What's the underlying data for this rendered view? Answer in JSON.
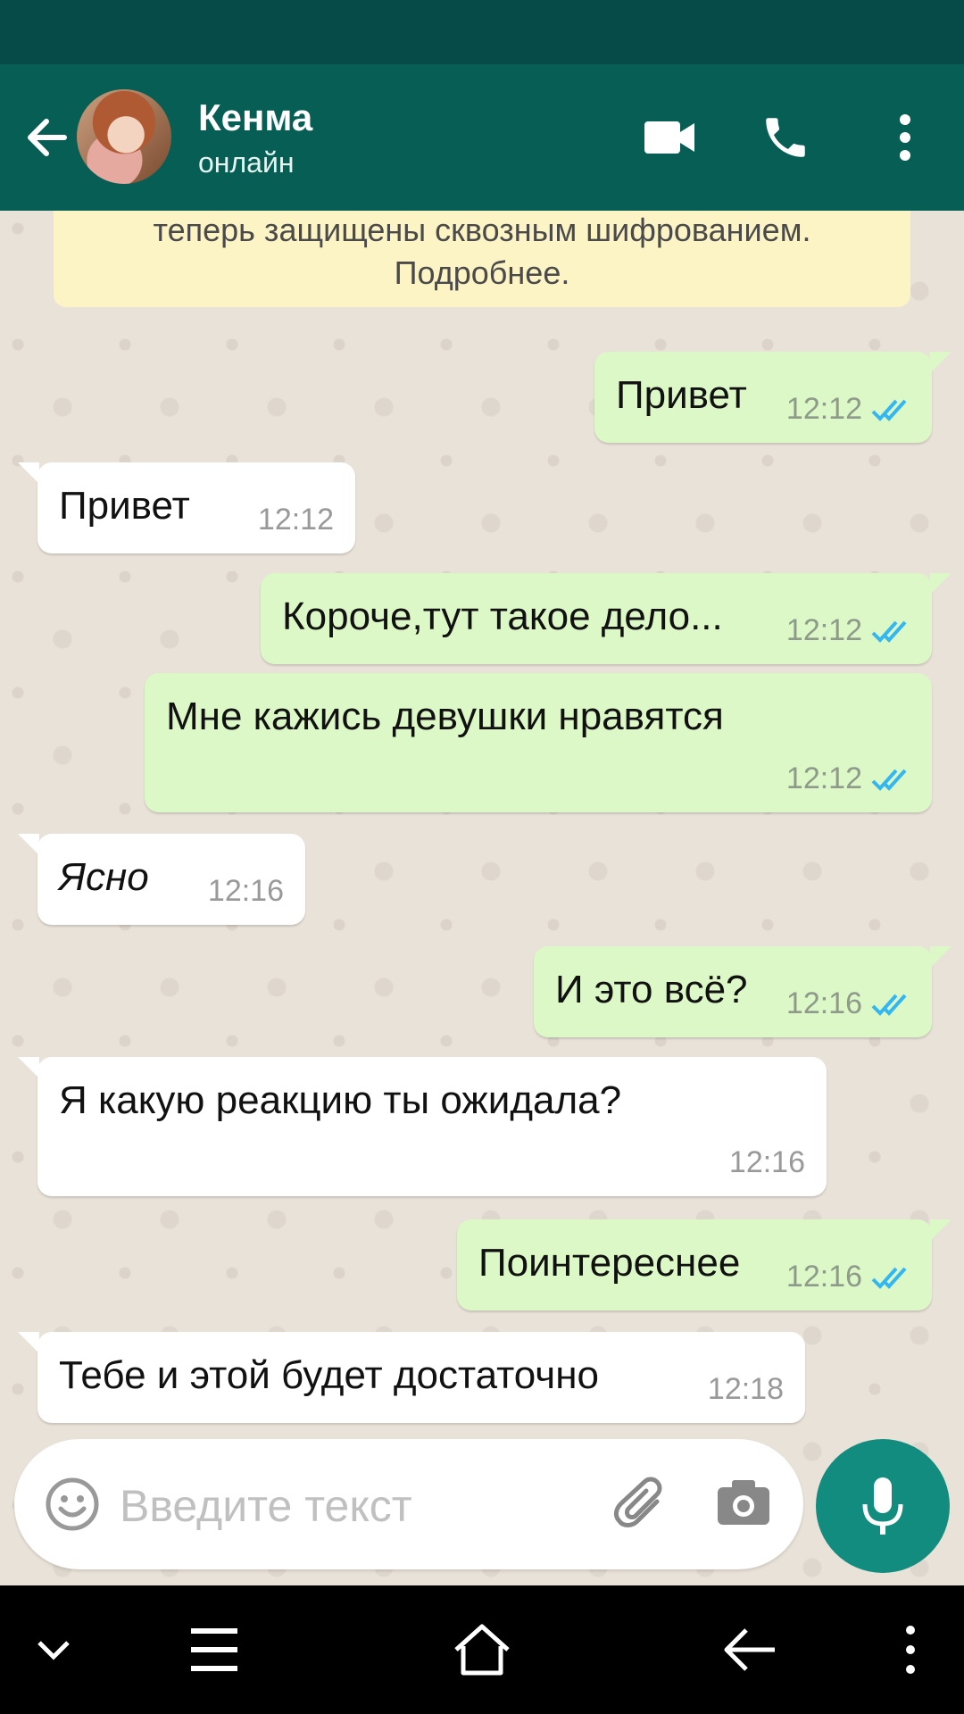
{
  "header": {
    "contact_name": "Кенма",
    "contact_status": "онлайн",
    "back_icon": "arrow-back-icon",
    "video_icon": "video-call-icon",
    "call_icon": "phone-icon",
    "menu_icon": "more-vert-icon"
  },
  "encryption_notice": {
    "line1": "теперь защищены сквозным шифрованием.",
    "line2": "Подробнее."
  },
  "messages": [
    {
      "direction": "out",
      "text": "Привет",
      "time": "12:12",
      "read": true
    },
    {
      "direction": "in",
      "text": "Привет",
      "time": "12:12"
    },
    {
      "direction": "out",
      "text": "Короче,тут такое дело...",
      "time": "12:12",
      "read": true
    },
    {
      "direction": "out",
      "text": "Мне кажись девушки нравятся",
      "time": "12:12",
      "read": true
    },
    {
      "direction": "in",
      "text": "Ясно",
      "time": "12:16",
      "italic": true
    },
    {
      "direction": "out",
      "text": "И это всё?",
      "time": "12:16",
      "read": true
    },
    {
      "direction": "in",
      "text": "Я какую реакцию ты ожидала?",
      "time": "12:16"
    },
    {
      "direction": "out",
      "text": "Поинтереснее",
      "time": "12:16",
      "read": true
    },
    {
      "direction": "in",
      "text": "Тебе и этой будет достаточно",
      "time": "12:18"
    }
  ],
  "composer": {
    "placeholder": "Введите текст",
    "emoji_icon": "emoji-icon",
    "attach_icon": "paperclip-icon",
    "camera_icon": "camera-icon",
    "mic_icon": "microphone-icon"
  },
  "colors": {
    "header": "#075e54",
    "outgoing_bubble": "#dcf8c6",
    "incoming_bubble": "#ffffff",
    "read_ticks": "#34b7f1",
    "mic_button": "#128c7e"
  },
  "navbar": {
    "icons": [
      "chevron-down-icon",
      "menu-icon",
      "home-icon",
      "back-icon",
      "more-vert-icon"
    ]
  }
}
